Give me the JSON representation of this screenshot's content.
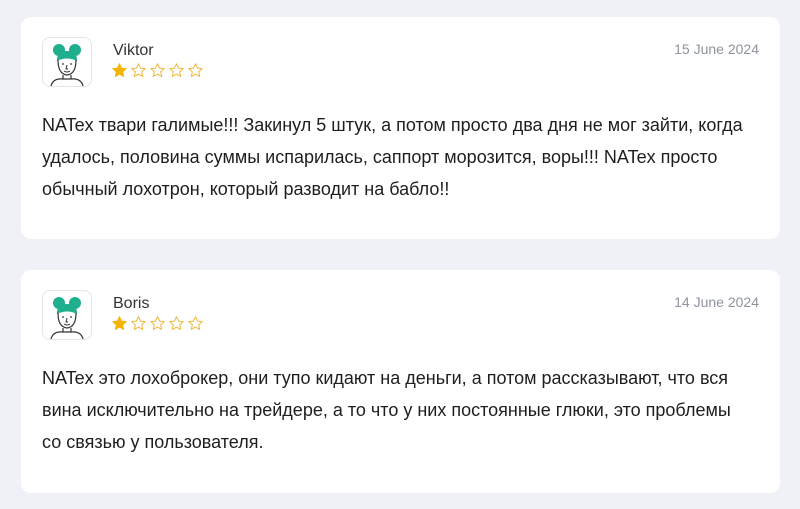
{
  "colors": {
    "star_filled": "#f5b400",
    "star_empty_outline": "#f0b63a",
    "avatar_hair": "#1fae8e",
    "background": "#eff1f6"
  },
  "reviews": [
    {
      "author": "Viktor",
      "date": "15 June 2024",
      "rating": 1,
      "max_rating": 5,
      "avatar_icon": "user-avatar-icon",
      "text": "NATex твари галимые!!! Закинул 5 штук, а потом просто два дня не мог зайти, когда удалось, половина суммы испарилась, саппорт морозится, воры!!! NATex просто обычный лохотрон, который разводит на бабло!!"
    },
    {
      "author": "Boris",
      "date": "14 June 2024",
      "rating": 1,
      "max_rating": 5,
      "avatar_icon": "user-avatar-icon",
      "text": "NATex это лохоброкер, они тупо кидают на деньги, а потом рассказывают, что вся вина исключительно на трейдере, а то что у них постоянные глюки, это проблемы со связью у пользователя."
    }
  ]
}
